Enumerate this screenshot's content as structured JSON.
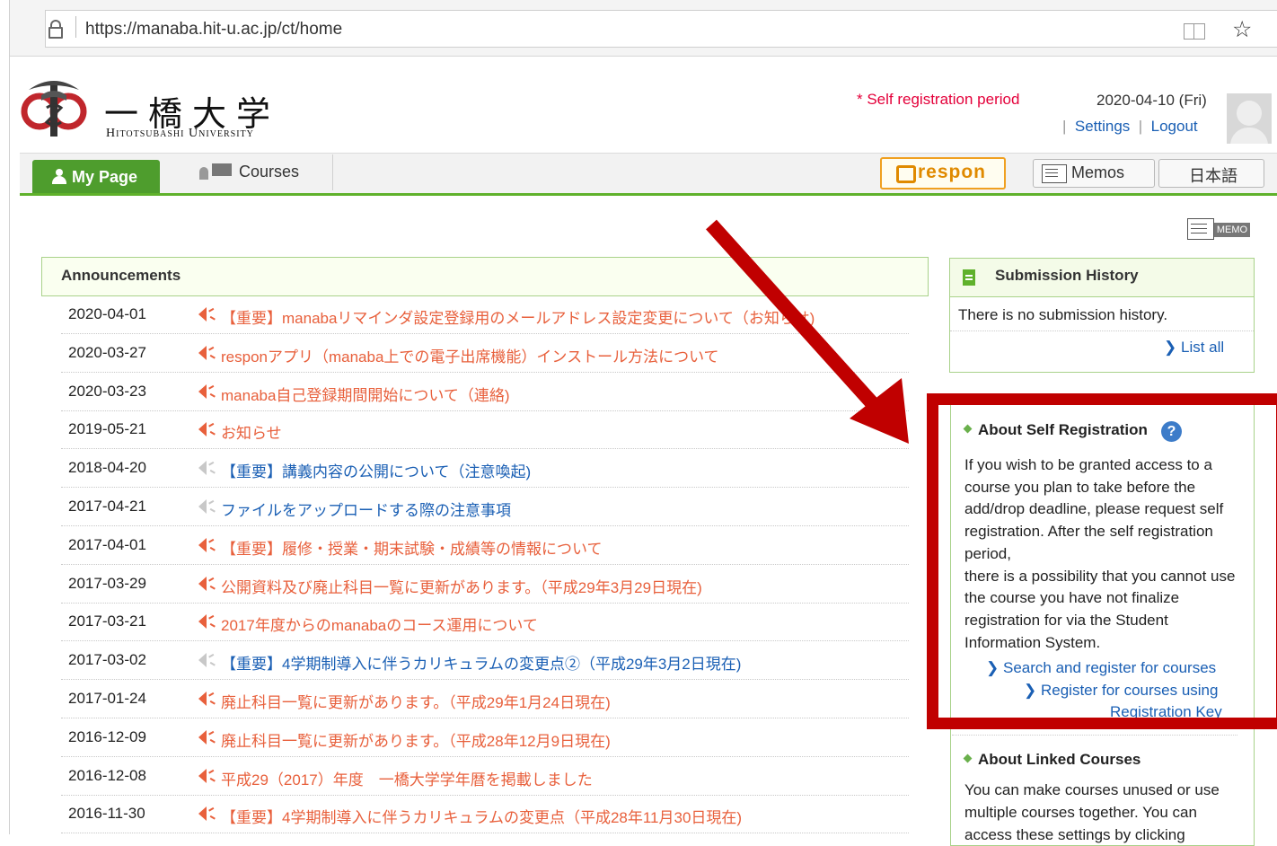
{
  "browser": {
    "url": "https://manaba.hit-u.ac.jp/ct/home"
  },
  "header": {
    "university_jp": "一橋大学",
    "university_en": "Hitotsubashi University",
    "self_registration_notice": "* Self registration period",
    "date": "2020-04-10 (Fri)",
    "settings_label": "Settings",
    "logout_label": "Logout",
    "link_separator": "|"
  },
  "nav": {
    "my_page": "My Page",
    "courses": "Courses",
    "respon": "respon",
    "memos": "Memos",
    "language": "日本語",
    "memo_badge": "MEMO"
  },
  "announcements": {
    "title": "Announcements",
    "items": [
      {
        "date": "2020-04-01",
        "title": "【重要】manabaリマインダ設定登録用のメールアドレス設定変更について（お知らせ)",
        "unread": true
      },
      {
        "date": "2020-03-27",
        "title": "responアプリ（manaba上での電子出席機能）インストール方法について",
        "unread": true
      },
      {
        "date": "2020-03-23",
        "title": "manaba自己登録期間開始について（連絡)",
        "unread": true
      },
      {
        "date": "2019-05-21",
        "title": "お知らせ",
        "unread": true
      },
      {
        "date": "2018-04-20",
        "title": "【重要】講義内容の公開について（注意喚起)",
        "unread": false
      },
      {
        "date": "2017-04-21",
        "title": "ファイルをアップロードする際の注意事項",
        "unread": false
      },
      {
        "date": "2017-04-01",
        "title": "【重要】履修・授業・期末試験・成績等の情報について",
        "unread": true
      },
      {
        "date": "2017-03-29",
        "title": "公開資料及び廃止科目一覧に更新があります。（平成29年3月29日現在)",
        "unread": true
      },
      {
        "date": "2017-03-21",
        "title": "2017年度からのmanabaのコース運用について",
        "unread": true
      },
      {
        "date": "2017-03-02",
        "title": "【重要】4学期制導入に伴うカリキュラムの変更点②（平成29年3月2日現在)",
        "unread": false
      },
      {
        "date": "2017-01-24",
        "title": "廃止科目一覧に更新があります。（平成29年1月24日現在)",
        "unread": true
      },
      {
        "date": "2016-12-09",
        "title": "廃止科目一覧に更新があります。（平成28年12月9日現在)",
        "unread": true
      },
      {
        "date": "2016-12-08",
        "title": "平成29（2017）年度　一橋大学学年暦を掲載しました",
        "unread": true
      },
      {
        "date": "2016-11-30",
        "title": "【重要】4学期制導入に伴うカリキュラムの変更点（平成28年11月30日現在)",
        "unread": true
      }
    ]
  },
  "submission_history": {
    "title": "Submission History",
    "empty_text": "There is no submission history.",
    "list_all": "List all"
  },
  "self_registration": {
    "title": "About Self Registration",
    "help": "?",
    "text": "If you wish to be granted access to a course you plan to take before the add/drop deadline, please request self registration. After the self registration period,\nthere is a possibility that you cannot use the course you have not finalize registration for via the Student Information System.",
    "search_link": "Search and register for courses",
    "key_link_1": "Register for courses using",
    "key_link_2": "Registration Key"
  },
  "linked_courses": {
    "title": "About Linked Courses",
    "text": "You can make courses unused or use multiple courses together. You can access these settings by clicking"
  },
  "colors": {
    "accent_green": "#4e9d2d",
    "announcement_unread": "#e8603c",
    "announcement_read": "#1a5fb4",
    "highlight_red": "#c00000"
  },
  "icons": [
    "lock-icon",
    "reader-icon",
    "star-icon",
    "university-logo",
    "person-icon",
    "courses-icon",
    "respon-icon",
    "memo-icon",
    "speaker-icon",
    "document-icon",
    "help-icon",
    "chevron-right-icon"
  ]
}
